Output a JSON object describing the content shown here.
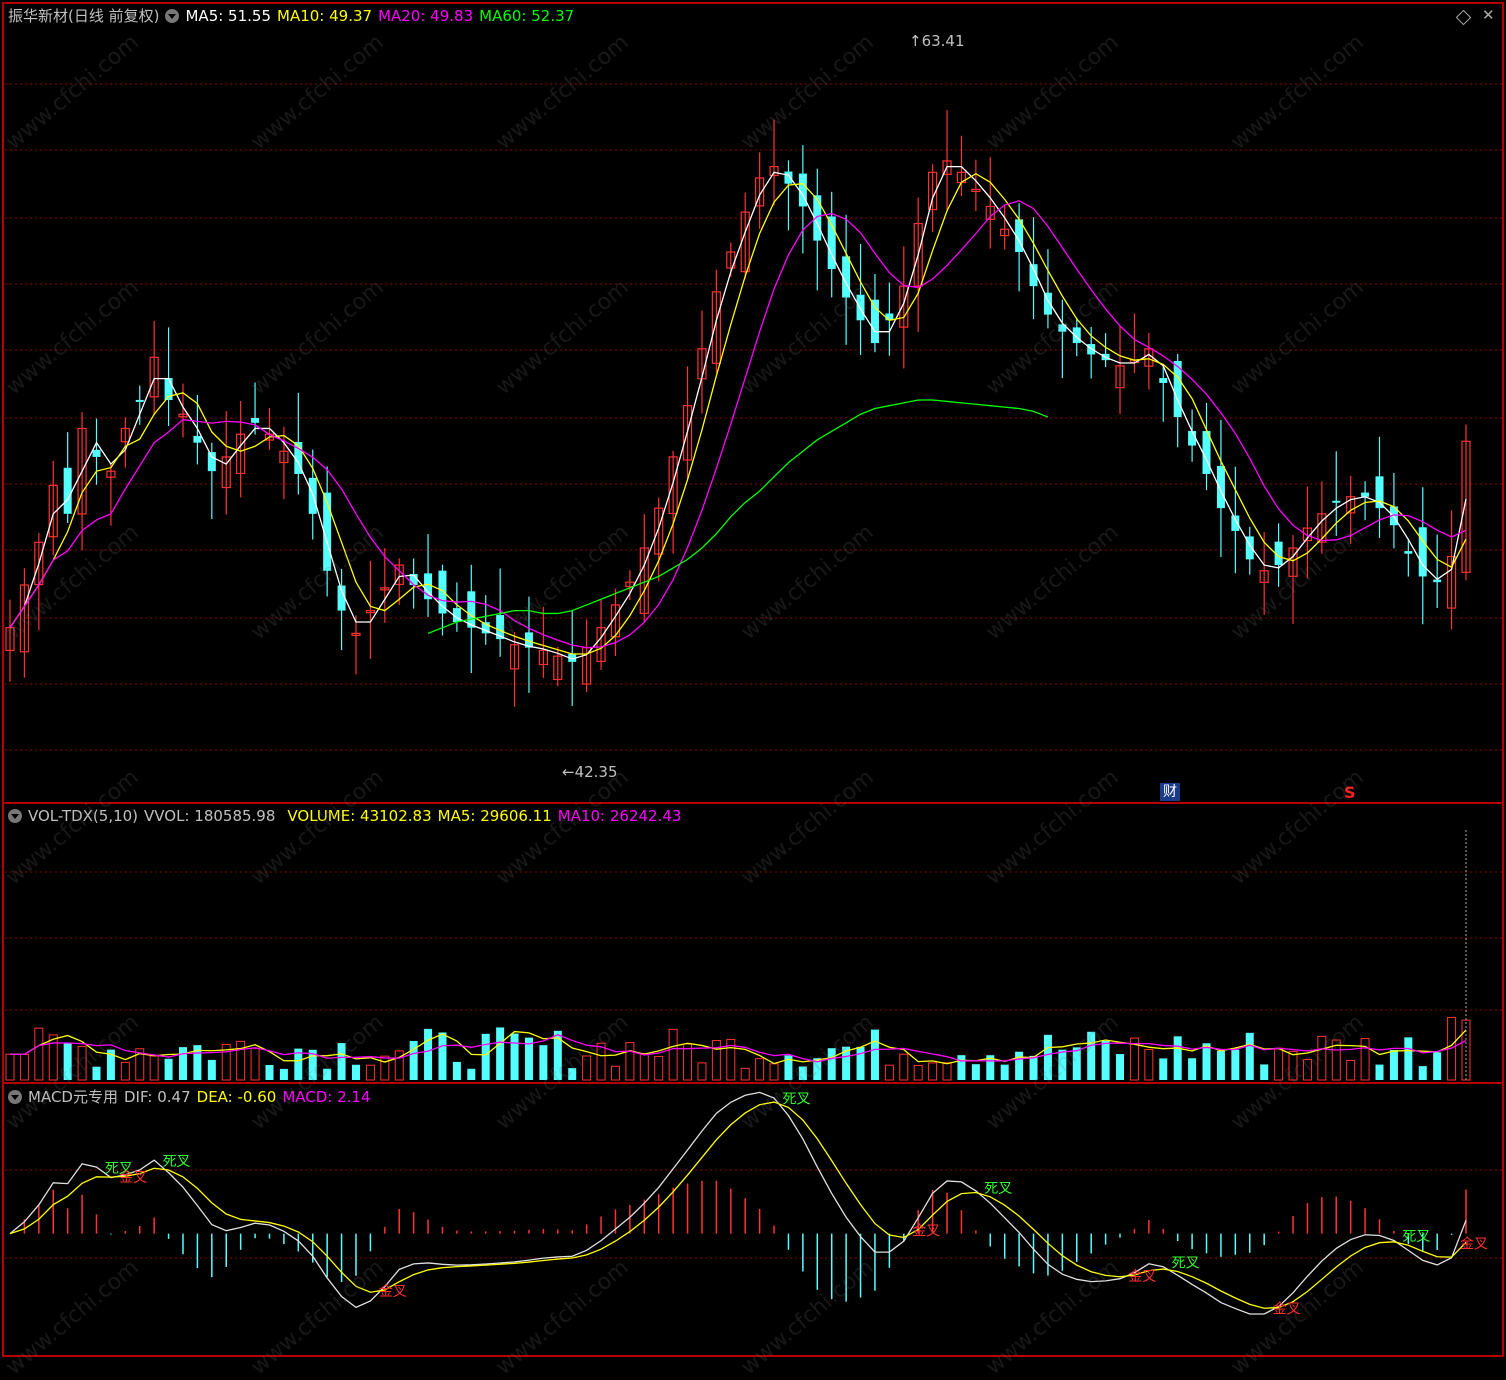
{
  "colors": {
    "up": "#ff3232",
    "down": "#54ffff",
    "ma5": "#ffffff",
    "ma10": "#ffff00",
    "ma20": "#ff00ff",
    "ma60": "#00ff00",
    "grid": "#8b0000",
    "border": "#b40000",
    "label": "#c0c0c0"
  },
  "price_header": {
    "title": "振华新材(日线 前复权)",
    "ma5": "MA5: 51.55",
    "ma10": "MA10: 49.37",
    "ma20": "MA20: 49.83",
    "ma60": "MA60: 52.37"
  },
  "vol_header": {
    "name": "VOL-TDX(5,10)",
    "vvol": "VVOL: 180585.98",
    "volume": "VOLUME: 43102.83",
    "ma5": "MA5: 29606.11",
    "ma10": "MA10: 26242.43"
  },
  "macd_header": {
    "name": "MACD元专用",
    "dif": "DIF: 0.47",
    "dea": "DEA: -0.60",
    "macd": "MACD: 2.14"
  },
  "annotations": {
    "high": "63.41",
    "low": "42.35",
    "fin_badge": "财",
    "s_badge": "S"
  },
  "signals": {
    "golden": "金叉",
    "death": "死叉"
  },
  "icons": [
    "dropdown-icon",
    "diamond-icon",
    "close-icon"
  ],
  "chart_data": {
    "type": "candlestick",
    "price_range": [
      40,
      66
    ],
    "closes": [
      45,
      46.5,
      48,
      50,
      49,
      52,
      51,
      50.5,
      52,
      53,
      54.5,
      53,
      52.5,
      51.5,
      50.5,
      51,
      51.8,
      52.2,
      51.8,
      51.2,
      50.4,
      49,
      47,
      45.6,
      44.8,
      45.6,
      46.4,
      47.2,
      46.5,
      46,
      45.5,
      45.2,
      45,
      44.8,
      44.6,
      44.4,
      44.3,
      44.2,
      44,
      43.8,
      44.3,
      45,
      45.8,
      46.6,
      47.8,
      49.2,
      51,
      52.8,
      54.8,
      56.8,
      58.2,
      59.6,
      60.8,
      61.2,
      60.6,
      59.8,
      58.6,
      57.6,
      56.6,
      55.8,
      55,
      55.8,
      57,
      59.2,
      61,
      61.4,
      61,
      60.4,
      59.8,
      59,
      58.2,
      57,
      56,
      55.4,
      55,
      54.6,
      54.4,
      54.2,
      54.4,
      54.8,
      53.6,
      52.4,
      51.4,
      50.4,
      49.2,
      48.4,
      47.4,
      47,
      47.2,
      47.8,
      48.5,
      49,
      49.4,
      49.6,
      49.6,
      49.2,
      48.6,
      47.6,
      46.8,
      46.6,
      47.5,
      51.55
    ],
    "ma60": [
      null,
      null,
      null,
      null,
      null,
      null,
      null,
      null,
      null,
      null,
      null,
      null,
      null,
      null,
      null,
      null,
      null,
      null,
      null,
      null,
      null,
      null,
      null,
      null,
      null,
      null,
      null,
      null,
      null,
      44.8,
      45,
      45.2,
      45.3,
      45.4,
      45.5,
      45.6,
      45.6,
      45.5,
      45.5,
      45.6,
      45.8,
      46,
      46.2,
      46.4,
      46.6,
      46.8,
      47.1,
      47.4,
      47.8,
      48.3,
      48.9,
      49.4,
      49.8,
      50.3,
      50.8,
      51.2,
      51.6,
      51.9,
      52.2,
      52.5,
      52.7,
      52.8,
      52.9,
      53,
      53,
      52.95,
      52.9,
      52.85,
      52.8,
      52.75,
      52.7,
      52.6,
      52.4
    ],
    "volume_range": [
      0,
      180000
    ],
    "macd_range": [
      -3.2,
      3.4
    ]
  }
}
